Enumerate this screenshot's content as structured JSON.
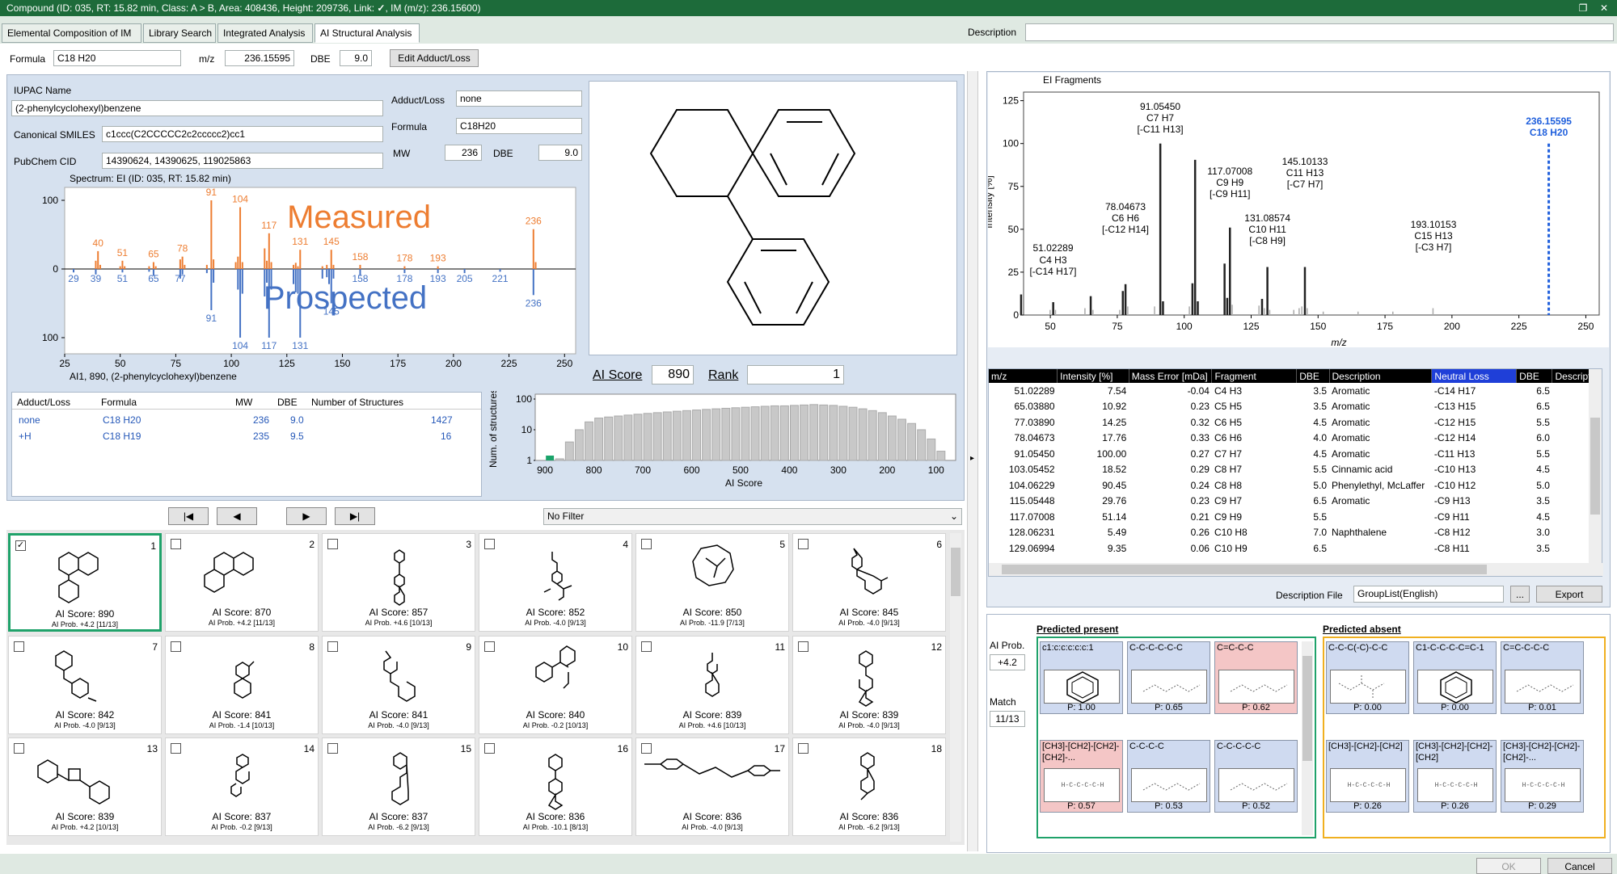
{
  "titlebar": {
    "text": "Compound (ID: 035, RT: 15.82 min, Class: A > B, Area: 408436, Height: 209736, Link:",
    "check": "✓",
    "text2": ", IM (m/z): 236.15600)"
  },
  "tabs": [
    "Elemental Composition of IM",
    "Library Search",
    "Integrated Analysis",
    "AI Structural Analysis"
  ],
  "description": {
    "label": "Description",
    "value": ""
  },
  "formula_bar": {
    "formula_label": "Formula",
    "formula": "C18 H20",
    "mz_label": "m/z",
    "mz": "236.15595",
    "dbe_label": "DBE",
    "dbe": "9.0",
    "edit_button": "Edit Adduct/Loss"
  },
  "info": {
    "iupac_label": "IUPAC Name",
    "iupac": "(2-phenylcyclohexyl)benzene",
    "smiles_label": "Canonical SMILES",
    "smiles": "c1ccc(C2CCCCC2c2ccccc2)cc1",
    "pubchem_label": "PubChem CID",
    "pubchem": "14390624, 14390625, 119025863",
    "adduct_label": "Adduct/Loss",
    "adduct": "none",
    "formula_label": "Formula",
    "formula": "C18H20",
    "mw_label": "MW",
    "mw": "236",
    "dbe_label": "DBE",
    "dbe": "9.0"
  },
  "spectrum": {
    "title": "Spectrum: EI (ID: 035, RT: 15.82 min)",
    "caption": "AI1, 890, (2-phenylcyclohexyl)benzene",
    "measured_label": "Measured",
    "prospected_label": "Prospected",
    "measured_color": "#ed7d31",
    "prospected_color": "#4472c4"
  },
  "score": {
    "ai_label": "AI Score",
    "ai_value": "890",
    "rank_label": "Rank",
    "rank_value": "1"
  },
  "adduct_table": {
    "headers": [
      "Adduct/Loss",
      "Formula",
      "MW",
      "DBE",
      "Number of Structures"
    ],
    "rows": [
      [
        "none",
        "C18 H20",
        "236",
        "9.0",
        "1427"
      ],
      [
        "+H",
        "C18 H19",
        "235",
        "9.5",
        "16"
      ]
    ]
  },
  "nav": {
    "first": "|◀",
    "prev": "◀",
    "next": "▶",
    "last": "▶|",
    "filter": "No Filter"
  },
  "candidates": [
    {
      "n": "1",
      "score": "AI Score: 890",
      "prob": "AI Prob. +4.2 [11/13]",
      "checked": true
    },
    {
      "n": "2",
      "score": "AI Score: 870",
      "prob": "AI Prob. +4.2 [11/13]"
    },
    {
      "n": "3",
      "score": "AI Score: 857",
      "prob": "AI Prob. +4.6 [10/13]"
    },
    {
      "n": "4",
      "score": "AI Score: 852",
      "prob": "AI Prob. -4.0 [9/13]"
    },
    {
      "n": "5",
      "score": "AI Score: 850",
      "prob": "AI Prob. -11.9 [7/13]"
    },
    {
      "n": "6",
      "score": "AI Score: 845",
      "prob": "AI Prob. -4.0 [9/13]"
    },
    {
      "n": "7",
      "score": "AI Score: 842",
      "prob": "AI Prob. -4.0 [9/13]"
    },
    {
      "n": "8",
      "score": "AI Score: 841",
      "prob": "AI Prob. -1.4 [10/13]"
    },
    {
      "n": "9",
      "score": "AI Score: 841",
      "prob": "AI Prob. -4.0 [9/13]"
    },
    {
      "n": "10",
      "score": "AI Score: 840",
      "prob": "AI Prob. -0.2 [10/13]"
    },
    {
      "n": "11",
      "score": "AI Score: 839",
      "prob": "AI Prob. +4.6 [10/13]"
    },
    {
      "n": "12",
      "score": "AI Score: 839",
      "prob": "AI Prob. -4.0 [9/13]"
    },
    {
      "n": "13",
      "score": "AI Score: 839",
      "prob": "AI Prob. +4.2 [10/13]"
    },
    {
      "n": "14",
      "score": "AI Score: 837",
      "prob": "AI Prob. -0.2 [9/13]"
    },
    {
      "n": "15",
      "score": "AI Score: 837",
      "prob": "AI Prob. -6.2 [9/13]"
    },
    {
      "n": "16",
      "score": "AI Score: 836",
      "prob": "AI Prob. -10.1 [8/13]"
    },
    {
      "n": "17",
      "score": "AI Score: 836",
      "prob": "AI Prob. -4.0 [9/13]"
    },
    {
      "n": "18",
      "score": "AI Score: 836",
      "prob": "AI Prob. -6.2 [9/13]"
    }
  ],
  "ei_fragments": {
    "title": "EI Fragments",
    "ylabel": "Intensity [%]",
    "xlabel": "m/z",
    "highlight": "236.15595",
    "highlight_formula": "C18 H20",
    "annotations": [
      [
        "51.02289",
        "C4 H3",
        "[-C14 H17]"
      ],
      [
        "78.04673",
        "C6 H6",
        "[-C12 H14]"
      ],
      [
        "91.05450",
        "C7 H7",
        "[-C11 H13]"
      ],
      [
        "117.07008",
        "C9 H9",
        "[-C9 H11]"
      ],
      [
        "131.08574",
        "C10 H11",
        "[-C8 H9]"
      ],
      [
        "145.10133",
        "C11 H13",
        "[-C7 H7]"
      ],
      [
        "193.10153",
        "C15 H13",
        "[-C3 H7]"
      ]
    ]
  },
  "fragment_table": {
    "headers": [
      "m/z",
      "Intensity [%]",
      "Mass Error [mDa]",
      "Fragment",
      "DBE",
      "Description",
      "Neutral Loss",
      "DBE",
      "Descripti"
    ],
    "rows": [
      [
        "51.02289",
        "7.54",
        "-0.04",
        "C4 H3",
        "3.5",
        "Aromatic",
        "-C14 H17",
        "6.5",
        ""
      ],
      [
        "65.03880",
        "10.92",
        "0.23",
        "C5 H5",
        "3.5",
        "Aromatic",
        "-C13 H15",
        "6.5",
        ""
      ],
      [
        "77.03890",
        "14.25",
        "0.32",
        "C6 H5",
        "4.5",
        "Aromatic",
        "-C12 H15",
        "5.5",
        ""
      ],
      [
        "78.04673",
        "17.76",
        "0.33",
        "C6 H6",
        "4.0",
        "Aromatic",
        "-C12 H14",
        "6.0",
        ""
      ],
      [
        "91.05450",
        "100.00",
        "0.27",
        "C7 H7",
        "4.5",
        "Aromatic",
        "-C11 H13",
        "5.5",
        ""
      ],
      [
        "103.05452",
        "18.52",
        "0.29",
        "C8 H7",
        "5.5",
        "Cinnamic acid",
        "-C10 H13",
        "4.5",
        ""
      ],
      [
        "104.06229",
        "90.45",
        "0.24",
        "C8 H8",
        "5.0",
        "Phenylethyl, McLaffer",
        "-C10 H12",
        "5.0",
        ""
      ],
      [
        "115.05448",
        "29.76",
        "0.23",
        "C9 H7",
        "6.5",
        "Aromatic",
        "-C9 H13",
        "3.5",
        ""
      ],
      [
        "117.07008",
        "51.14",
        "0.21",
        "C9 H9",
        "5.5",
        "",
        "-C9 H11",
        "4.5",
        ""
      ],
      [
        "128.06231",
        "5.49",
        "0.26",
        "C10 H8",
        "7.0",
        "Naphthalene",
        "-C8 H12",
        "3.0",
        ""
      ],
      [
        "129.06994",
        "9.35",
        "0.06",
        "C10 H9",
        "6.5",
        "",
        "-C8 H11",
        "3.5",
        ""
      ]
    ]
  },
  "desc_file": {
    "label": "Description File",
    "value": "GroupList(English)",
    "browse": "...",
    "export": "Export"
  },
  "predicted": {
    "present_title": "Predicted present",
    "absent_title": "Predicted absent",
    "ai_prob_label": "AI Prob.",
    "ai_prob": "+4.2",
    "match_label": "Match",
    "match": "11/13",
    "present": [
      {
        "t": "c1:c:c:c:c:c:1",
        "p": "P: 1.00",
        "red": false
      },
      {
        "t": "C-C-C-C-C-C",
        "p": "P: 0.65",
        "red": false
      },
      {
        "t": "C=C-C-C",
        "p": "P: 0.62",
        "red": true
      },
      {
        "t": "[CH3]-[CH2]-[CH2]-[CH2]-...",
        "p": "P: 0.57",
        "red": true
      },
      {
        "t": "C-C-C-C",
        "p": "P: 0.53",
        "red": false
      },
      {
        "t": "C-C-C-C-C",
        "p": "P: 0.52",
        "red": false
      }
    ],
    "absent": [
      {
        "t": "C-C-C(-C)-C-C",
        "p": "P: 0.00"
      },
      {
        "t": "C1-C-C-C-C=C-1",
        "p": "P: 0.00"
      },
      {
        "t": "C=C-C-C-C",
        "p": "P: 0.01"
      },
      {
        "t": "[CH3]-[CH2]-[CH2]",
        "p": "P: 0.26"
      },
      {
        "t": "[CH3]-[CH2]-[CH2]-[CH2]",
        "p": "P: 0.26"
      },
      {
        "t": "[CH3]-[CH2]-[CH2]-[CH2]-...",
        "p": "P: 0.29"
      }
    ]
  },
  "footer": {
    "ok": "OK",
    "cancel": "Cancel"
  },
  "chart_data": [
    {
      "type": "bar",
      "title": "Spectrum: EI (ID: 035, RT: 15.82 min)",
      "xlabel": "",
      "ylabel": "",
      "xlim": [
        25,
        255
      ],
      "ylim": [
        -100,
        100
      ],
      "xticks": [
        25,
        50,
        75,
        100,
        125,
        150,
        175,
        200,
        225,
        250
      ],
      "yticks": [
        100,
        0,
        100
      ],
      "series": [
        {
          "name": "Measured",
          "labels": [
            40,
            51,
            65,
            78,
            91,
            104,
            117,
            131,
            145,
            158,
            178,
            193,
            236
          ],
          "peaks": [
            [
              39,
              12
            ],
            [
              40,
              26
            ],
            [
              41,
              6
            ],
            [
              50,
              4
            ],
            [
              51,
              12
            ],
            [
              52,
              4
            ],
            [
              63,
              4
            ],
            [
              65,
              10
            ],
            [
              66,
              4
            ],
            [
              77,
              14
            ],
            [
              78,
              18
            ],
            [
              79,
              6
            ],
            [
              89,
              6
            ],
            [
              91,
              100
            ],
            [
              92,
              14
            ],
            [
              102,
              10
            ],
            [
              103,
              18
            ],
            [
              104,
              90
            ],
            [
              105,
              10
            ],
            [
              115,
              30
            ],
            [
              116,
              12
            ],
            [
              117,
              52
            ],
            [
              118,
              10
            ],
            [
              128,
              6
            ],
            [
              129,
              9
            ],
            [
              130,
              4
            ],
            [
              131,
              28
            ],
            [
              141,
              4
            ],
            [
              143,
              6
            ],
            [
              145,
              28
            ],
            [
              146,
              6
            ],
            [
              158,
              6
            ],
            [
              178,
              4
            ],
            [
              193,
              4
            ],
            [
              236,
              58
            ],
            [
              237,
              10
            ]
          ]
        },
        {
          "name": "Prospected",
          "labels": [
            29,
            39,
            51,
            65,
            77,
            91,
            104,
            117,
            131,
            145,
            158,
            178,
            193,
            205,
            221,
            236
          ],
          "peaks": [
            [
              29,
              5
            ],
            [
              39,
              8
            ],
            [
              51,
              5
            ],
            [
              63,
              4
            ],
            [
              65,
              10
            ],
            [
              77,
              14
            ],
            [
              78,
              8
            ],
            [
              89,
              6
            ],
            [
              91,
              60
            ],
            [
              92,
              20
            ],
            [
              103,
              30
            ],
            [
              104,
              100
            ],
            [
              105,
              36
            ],
            [
              115,
              40
            ],
            [
              116,
              20
            ],
            [
              117,
              100
            ],
            [
              118,
              30
            ],
            [
              128,
              22
            ],
            [
              129,
              34
            ],
            [
              130,
              36
            ],
            [
              131,
              100
            ],
            [
              141,
              14
            ],
            [
              143,
              12
            ],
            [
              144,
              22
            ],
            [
              145,
              50
            ],
            [
              146,
              14
            ],
            [
              158,
              10
            ],
            [
              178,
              6
            ],
            [
              193,
              6
            ],
            [
              205,
              6
            ],
            [
              221,
              4
            ],
            [
              236,
              38
            ]
          ]
        }
      ]
    },
    {
      "type": "bar",
      "title": "",
      "xlabel": "AI Score",
      "ylabel": "Num. of structures",
      "scale": "log",
      "xlim": [
        920,
        60
      ],
      "ylim": [
        1,
        100
      ],
      "xticks": [
        900,
        800,
        700,
        600,
        500,
        400,
        300,
        200,
        100
      ],
      "yticks": [
        100,
        10,
        1
      ],
      "x": [
        890,
        870,
        850,
        830,
        810,
        790,
        770,
        750,
        730,
        710,
        690,
        670,
        650,
        630,
        610,
        590,
        570,
        550,
        530,
        510,
        490,
        470,
        450,
        430,
        410,
        390,
        370,
        350,
        330,
        310,
        290,
        270,
        250,
        230,
        210,
        190,
        170,
        150,
        130,
        110,
        90
      ],
      "values": [
        1,
        1,
        4,
        10,
        18,
        24,
        26,
        28,
        30,
        32,
        34,
        36,
        38,
        40,
        42,
        44,
        46,
        48,
        50,
        52,
        54,
        56,
        58,
        60,
        60,
        62,
        64,
        66,
        64,
        62,
        58,
        54,
        48,
        42,
        36,
        28,
        22,
        16,
        10,
        5,
        2
      ],
      "highlight_index": 0,
      "highlight_color": "#1aa36a"
    },
    {
      "type": "bar",
      "title": "EI Fragments",
      "xlabel": "m/z",
      "ylabel": "Intensity [%]",
      "xlim": [
        40,
        255
      ],
      "ylim": [
        0,
        130
      ],
      "xticks": [
        50,
        75,
        100,
        125,
        150,
        175,
        200,
        225,
        250
      ],
      "yticks": [
        0,
        25,
        50,
        75,
        100,
        125
      ],
      "peaks": [
        [
          39,
          12
        ],
        [
          50,
          3
        ],
        [
          51,
          7.5
        ],
        [
          52,
          3
        ],
        [
          63,
          4
        ],
        [
          65,
          11
        ],
        [
          66,
          3
        ],
        [
          76,
          3
        ],
        [
          77,
          14
        ],
        [
          78,
          18
        ],
        [
          79,
          5
        ],
        [
          89,
          5
        ],
        [
          91,
          100
        ],
        [
          92,
          8
        ],
        [
          102,
          5
        ],
        [
          103,
          18.5
        ],
        [
          104,
          90.5
        ],
        [
          105,
          8
        ],
        [
          115,
          30
        ],
        [
          116,
          10
        ],
        [
          117,
          51
        ],
        [
          118,
          6
        ],
        [
          128,
          5.5
        ],
        [
          129,
          9.4
        ],
        [
          130,
          4
        ],
        [
          131,
          28
        ],
        [
          132,
          3
        ],
        [
          141,
          3
        ],
        [
          143,
          4
        ],
        [
          144,
          5
        ],
        [
          145,
          28
        ],
        [
          146,
          4
        ],
        [
          152,
          2
        ],
        [
          165,
          2
        ],
        [
          178,
          2
        ],
        [
          193,
          4
        ],
        [
          236,
          100
        ]
      ],
      "highlight_x": 236.15595,
      "highlight_color": "#1f5fdc"
    }
  ]
}
